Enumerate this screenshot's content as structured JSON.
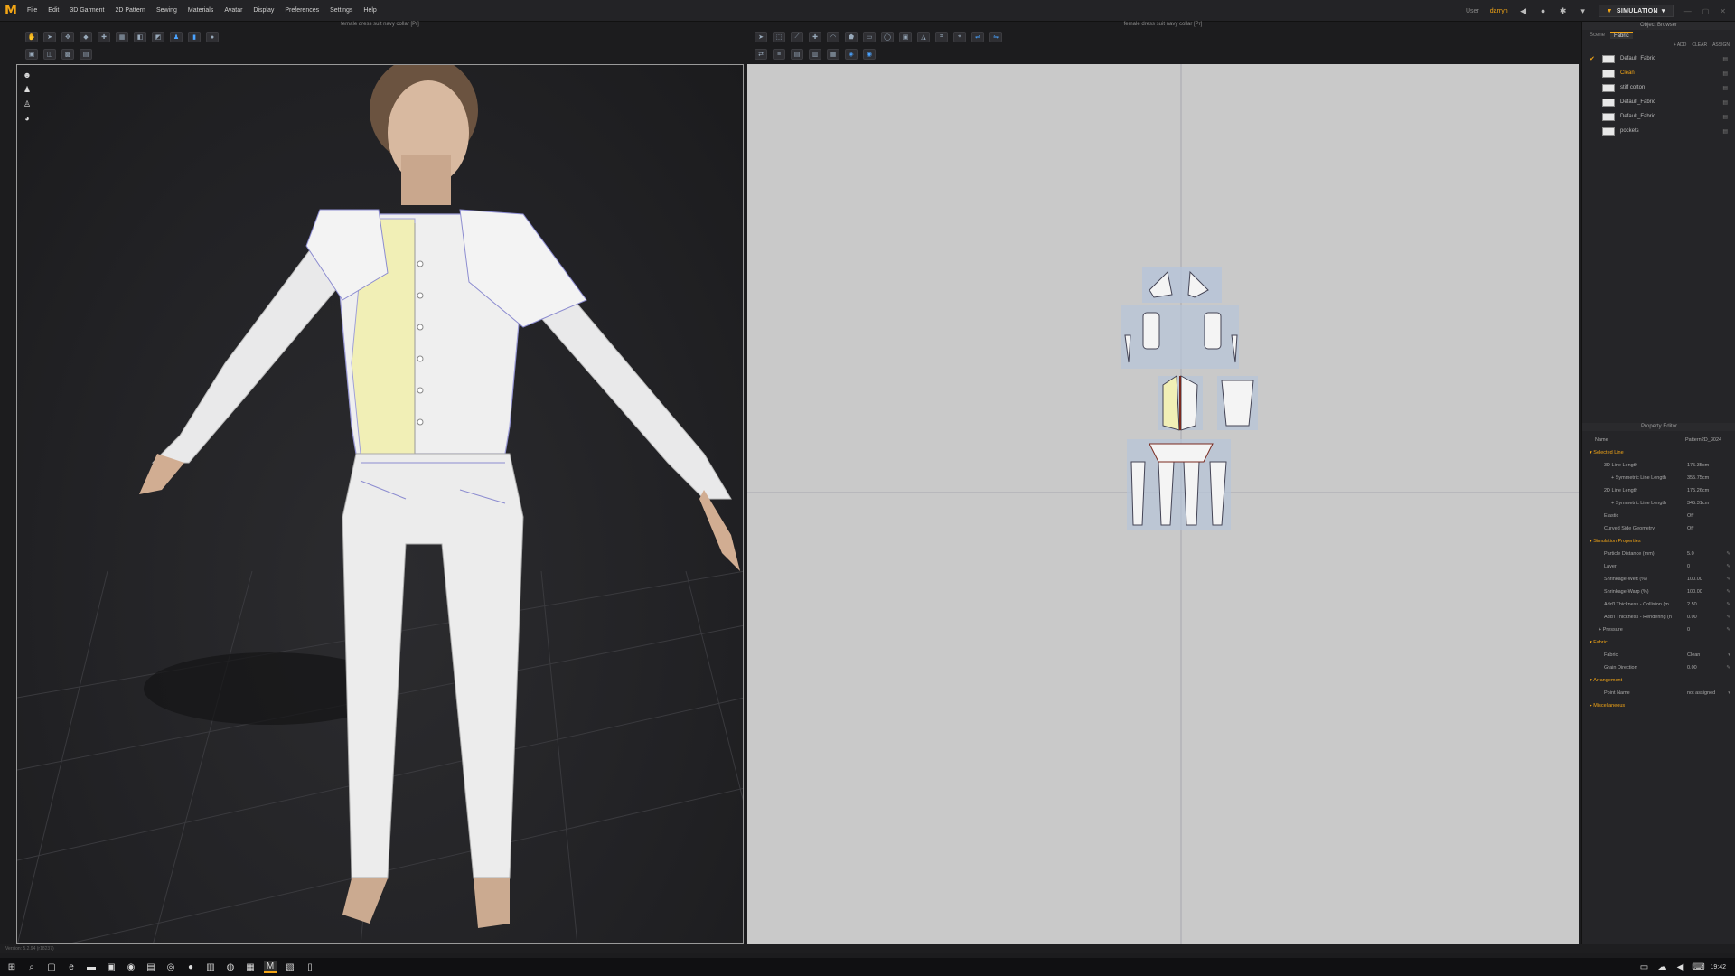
{
  "menubar": {
    "logo": "M",
    "items": [
      "File",
      "Edit",
      "3D Garment",
      "2D Pattern",
      "Sewing",
      "Materials",
      "Avatar",
      "Display",
      "Preferences",
      "Settings",
      "Help"
    ],
    "user_label": "User",
    "user_name": "darryn",
    "simulation_label": "SIMULATION",
    "accent": "#f2a516"
  },
  "panels": {
    "view3d_title": "female dress suit navy collar [Pr]",
    "view2d_title": "female dress suit navy collar [Pr]"
  },
  "object_browser": {
    "title": "Object Browser",
    "tabs": [
      "Scene",
      "Fabric"
    ],
    "active_tab": "Fabric",
    "actions": [
      "+ ADD",
      "CLEAR",
      "ASSIGN"
    ],
    "fabrics": [
      {
        "name": "Default_Fabric",
        "checked": true,
        "active": false
      },
      {
        "name": "Clean",
        "checked": false,
        "active": true
      },
      {
        "name": "stiff cotton",
        "checked": false,
        "active": false
      },
      {
        "name": "Default_Fabric",
        "checked": false,
        "active": false
      },
      {
        "name": "Default_Fabric",
        "checked": false,
        "active": false
      },
      {
        "name": "pockets",
        "checked": false,
        "active": false
      }
    ]
  },
  "property_editor": {
    "title": "Property Editor",
    "name_label": "Name",
    "name_value": "Pattern2D_3024",
    "sections": {
      "selected_line": "Selected Line",
      "simulation": "Simulation Properties",
      "fabric": "Fabric",
      "arrangement": "Arrangement",
      "misc": "Miscellaneous"
    },
    "selected_line_rows": [
      {
        "label": "3D Line Length",
        "value": "175.35cm"
      },
      {
        "label": "+ Symmetric Line Length",
        "value": "355.75cm"
      },
      {
        "label": "2D Line Length",
        "value": "175.26cm"
      },
      {
        "label": "+ Symmetric Line Length",
        "value": "345.31cm"
      },
      {
        "label": "Elastic",
        "value": "Off"
      },
      {
        "label": "Curved Side Geometry",
        "value": "Off"
      }
    ],
    "simulation_rows": [
      {
        "label": "Particle Distance (mm)",
        "value": "5.0"
      },
      {
        "label": "Layer",
        "value": "0"
      },
      {
        "label": "Shrinkage-Weft (%)",
        "value": "100.00"
      },
      {
        "label": "Shrinkage-Warp (%)",
        "value": "100.00"
      },
      {
        "label": "Add'l Thickness - Collision (m",
        "value": "2.50"
      },
      {
        "label": "Add'l Thickness - Rendering (n",
        "value": "0.00"
      },
      {
        "label": "+ Pressure",
        "value": "0"
      }
    ],
    "fabric_rows": [
      {
        "label": "Fabric",
        "value": "Clean"
      },
      {
        "label": "Grain Direction",
        "value": "0.00"
      }
    ],
    "arrangement_rows": [
      {
        "label": "Point Name",
        "value": "not assigned"
      }
    ]
  },
  "statusbar": {
    "text": "Version: 5.2.94    (r18237)"
  },
  "taskbar": {
    "time": "19:42"
  }
}
